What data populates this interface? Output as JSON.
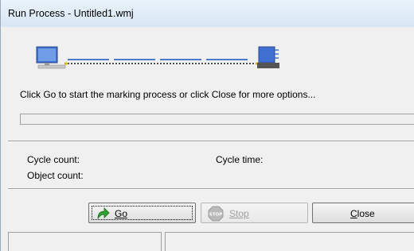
{
  "window": {
    "title": "Run Process - Untitled1.wmj"
  },
  "banner": {
    "left_icon": "computer-icon",
    "right_icon": "laser-marker-icon",
    "line_color": "#4f79c9",
    "dot_color": "#e5c000"
  },
  "status": {
    "message": "Click Go to start the marking process or click Close for more options...",
    "progress_fraction": 0
  },
  "info": {
    "cycle_count_label": "Cycle count:",
    "cycle_time_label": "Cycle time:",
    "object_count_label": "Object count:"
  },
  "buttons": {
    "go_label": "Go",
    "go_icon": "green-arrow-icon",
    "stop_label": "Stop",
    "stop_icon": "stop-sign-icon",
    "close_label": "Close"
  }
}
